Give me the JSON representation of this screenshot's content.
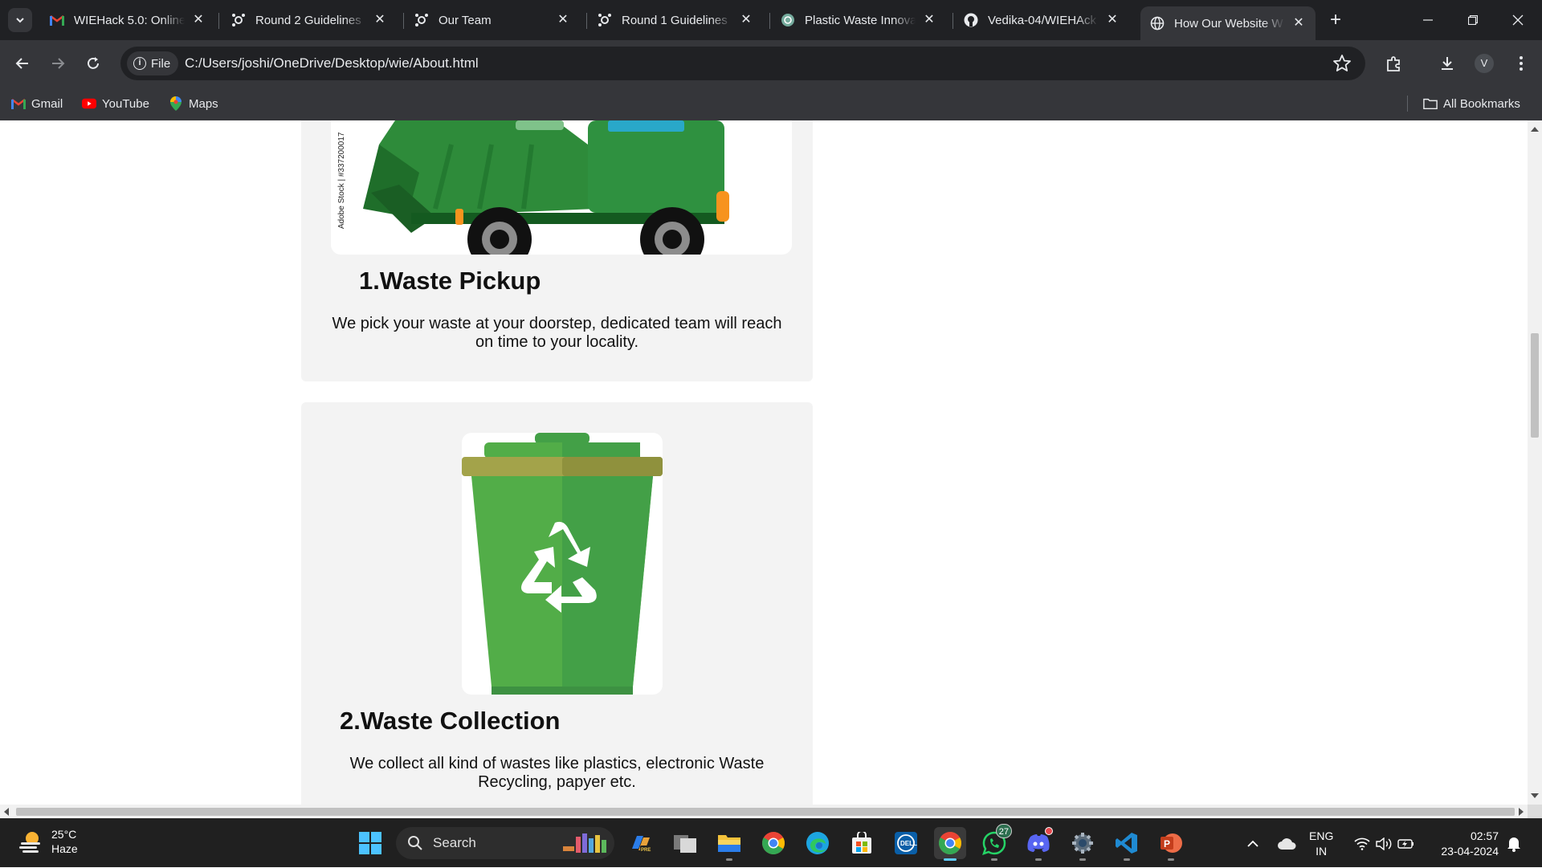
{
  "tabs": [
    {
      "title": "WIEHack 5.0: Online",
      "icon": "gmail-icon"
    },
    {
      "title": "Round 2 Guidelines",
      "icon": "hackathon-logo-icon"
    },
    {
      "title": "Our Team",
      "icon": "hackathon-logo-icon"
    },
    {
      "title": "Round 1 Guidelines",
      "icon": "hackathon-logo-icon"
    },
    {
      "title": "Plastic Waste Innova",
      "icon": "chatgpt-icon"
    },
    {
      "title": "Vedika-04/WIEHAck",
      "icon": "github-icon"
    },
    {
      "title": "How Our Website W",
      "icon": "globe-icon",
      "active": true
    }
  ],
  "address_bar": {
    "scheme_chip": "File",
    "url": "C:/Users/joshi/OneDrive/Desktop/wie/About.html"
  },
  "profile_initial": "V",
  "bookmarks": {
    "items": [
      {
        "label": "Gmail",
        "icon": "gmail-icon"
      },
      {
        "label": "YouTube",
        "icon": "youtube-icon"
      },
      {
        "label": "Maps",
        "icon": "maps-pin-icon"
      }
    ],
    "all_label": "All Bookmarks"
  },
  "content": {
    "cards": [
      {
        "title": "1.Waste Pickup",
        "description": "We pick your waste at your doorstep, dedicated team will reach on time to your locality.",
        "image": "garbage-truck",
        "watermark": "Adobe Stock | #337200017"
      },
      {
        "title": "2.Waste Collection",
        "description": "We collect all kind of wastes like plastics, electronic Waste Recycling, papyer etc.",
        "image": "recycle-bin"
      }
    ]
  },
  "taskbar": {
    "weather": {
      "temp": "25°C",
      "condition": "Haze"
    },
    "search_placeholder": "Search",
    "whatsapp_badge": "27",
    "language": {
      "line1": "ENG",
      "line2": "IN"
    },
    "clock": {
      "time": "02:57",
      "date": "23-04-2024"
    }
  },
  "colors": {
    "chrome_dark": "#202124",
    "chrome_toolbar": "#35363a",
    "card_bg": "#f3f3f3",
    "bin_green": "#52ad48",
    "bin_dark_green": "#43a047",
    "bin_lid_olive": "#9c9e44",
    "truck_green": "#2e8b3a"
  }
}
